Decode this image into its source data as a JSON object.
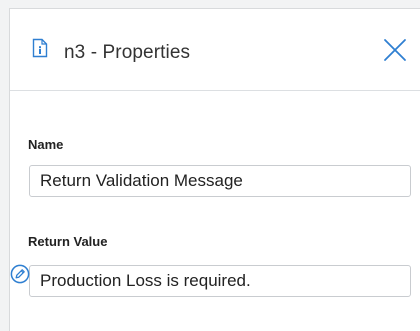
{
  "panel": {
    "title": "n3 - Properties",
    "title_icon": "document-info-icon",
    "close_icon": "close-icon"
  },
  "fields": {
    "name": {
      "label": "Name",
      "value": "Return Validation Message"
    },
    "return_value": {
      "label": "Return Value",
      "value": "Production Loss is required.",
      "edit_icon": "pencil-circle-icon"
    }
  },
  "colors": {
    "accent": "#2f7fd1",
    "background": "#f2f3f4",
    "panel": "#ffffff",
    "border": "#c9ccd0"
  }
}
